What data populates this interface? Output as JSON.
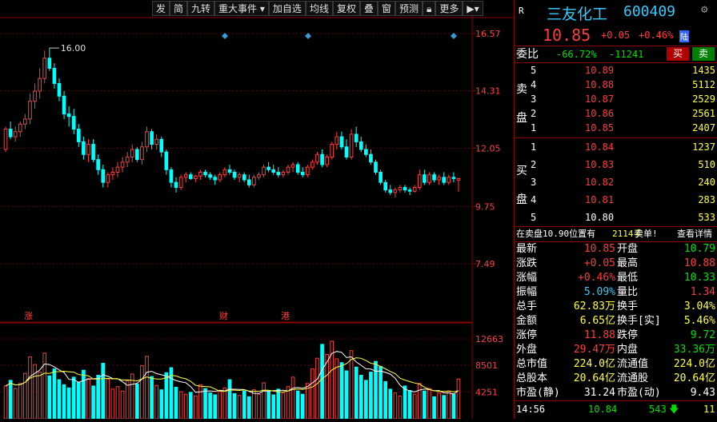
{
  "toolbar": {
    "items": [
      "发",
      "简",
      "九转",
      "重大事件",
      "加自选",
      "均线",
      "复权",
      "叠",
      "窗",
      "预测",
      "锁",
      "更多",
      "播放"
    ]
  },
  "price_axis": [
    "16.57",
    "14.31",
    "12.05",
    "9.75",
    "7.49"
  ],
  "volume_axis": [
    "12663",
    "8501",
    "4251"
  ],
  "peak_label": "16.00",
  "event_markers": [
    "涨",
    "财",
    "港"
  ],
  "header": {
    "badge": "R",
    "name": "三友化工",
    "code": "600409",
    "price": "10.85",
    "change": "+0.05",
    "change_pct": "+0.46%",
    "exchange": "陆"
  },
  "webi": {
    "label": "委比",
    "pct": "-66.72%",
    "diff": "-11241",
    "buy_btn": "买",
    "sell_btn": "卖"
  },
  "sell_side": {
    "side_label_1": "卖",
    "side_label_2": "盘",
    "levels": [
      {
        "lvl": "5",
        "price": "10.89",
        "vol": "1435"
      },
      {
        "lvl": "4",
        "price": "10.88",
        "vol": "5112"
      },
      {
        "lvl": "3",
        "price": "10.87",
        "vol": "2529"
      },
      {
        "lvl": "2",
        "price": "10.86",
        "vol": "2561"
      },
      {
        "lvl": "1",
        "price": "10.85",
        "vol": "2407"
      }
    ]
  },
  "buy_side": {
    "side_label_1": "买",
    "side_label_2": "盘",
    "levels": [
      {
        "lvl": "1",
        "price": "10.84",
        "vol": "1237"
      },
      {
        "lvl": "2",
        "price": "10.83",
        "vol": "510"
      },
      {
        "lvl": "3",
        "price": "10.82",
        "vol": "240"
      },
      {
        "lvl": "4",
        "price": "10.81",
        "vol": "283"
      },
      {
        "lvl": "5",
        "price": "10.80",
        "vol": "533"
      }
    ]
  },
  "notice": {
    "pre": "在卖盘10.90位置有",
    "qty": "2114手",
    "post": "卖单!",
    "link": "查看详情"
  },
  "stats": [
    {
      "l1": "最新",
      "v1": "10.85",
      "c1": "red",
      "l2": "开盘",
      "v2": "10.79",
      "c2": "green"
    },
    {
      "l1": "涨跌",
      "v1": "+0.05",
      "c1": "red",
      "l2": "最高",
      "v2": "10.88",
      "c2": "red"
    },
    {
      "l1": "涨幅",
      "v1": "+0.46%",
      "c1": "red",
      "l2": "最低",
      "v2": "10.33",
      "c2": "green"
    },
    {
      "l1": "振幅",
      "v1": "5.09%",
      "c1": "cyan",
      "l2": "量比",
      "v2": "1.34",
      "c2": "red"
    },
    {
      "l1": "总手",
      "v1": "62.83万",
      "c1": "yellow",
      "l2": "换手",
      "v2": "3.04%",
      "c2": "yellow"
    },
    {
      "l1": "金额",
      "v1": "6.65亿",
      "c1": "yellow",
      "l2": "换手[实]",
      "v2": "5.46%",
      "c2": "yellow"
    },
    {
      "l1": "涨停",
      "v1": "11.88",
      "c1": "red",
      "l2": "跌停",
      "v2": "9.72",
      "c2": "green"
    },
    {
      "l1": "外盘",
      "v1": "29.47万",
      "c1": "red",
      "l2": "内盘",
      "v2": "33.36万",
      "c2": "green"
    },
    {
      "l1": "总市值",
      "v1": "224.0亿",
      "c1": "yellow",
      "l2": "流通值",
      "v2": "224.0亿",
      "c2": "yellow"
    },
    {
      "l1": "总股本",
      "v1": "20.64亿",
      "c1": "yellow",
      "l2": "流通股",
      "v2": "20.64亿",
      "c2": "yellow"
    },
    {
      "l1": "市盈(静)",
      "v1": "31.24",
      "c1": "white",
      "l2": "市盈(动)",
      "v2": "9.43",
      "c2": "white"
    }
  ],
  "tick": {
    "time": "14:56",
    "price": "10.84",
    "vol": "543",
    "count": "11"
  },
  "colors": {
    "up": "#ff3c3c",
    "down": "#00ffff",
    "frame": "#8b0000"
  },
  "chart_data": {
    "type": "candlestick",
    "yaxis_price": [
      7.49,
      16.57
    ],
    "yaxis_volume": [
      0,
      12663
    ],
    "candles": [
      [
        12.0,
        12.9,
        11.9,
        12.8
      ],
      [
        12.8,
        13.1,
        12.4,
        12.5
      ],
      [
        12.5,
        12.9,
        12.3,
        12.7
      ],
      [
        12.7,
        13.1,
        12.5,
        13.0
      ],
      [
        13.0,
        13.4,
        12.8,
        13.2
      ],
      [
        13.2,
        14.2,
        13.0,
        13.9
      ],
      [
        13.9,
        14.6,
        13.6,
        14.3
      ],
      [
        14.3,
        15.2,
        14.0,
        14.8
      ],
      [
        14.8,
        15.9,
        14.6,
        15.6
      ],
      [
        15.6,
        16.0,
        15.1,
        15.2
      ],
      [
        15.2,
        15.4,
        14.4,
        14.6
      ],
      [
        14.6,
        14.8,
        13.9,
        14.1
      ],
      [
        14.1,
        14.3,
        13.2,
        13.4
      ],
      [
        13.4,
        13.7,
        12.9,
        13.3
      ],
      [
        13.3,
        13.6,
        12.6,
        12.8
      ],
      [
        12.8,
        13.0,
        12.1,
        12.3
      ],
      [
        12.3,
        12.5,
        11.6,
        11.8
      ],
      [
        11.8,
        12.4,
        11.5,
        12.2
      ],
      [
        12.2,
        12.4,
        11.5,
        11.6
      ],
      [
        11.6,
        11.8,
        11.0,
        11.2
      ],
      [
        11.2,
        11.4,
        10.5,
        10.7
      ],
      [
        10.7,
        11.1,
        10.5,
        11.0
      ],
      [
        11.0,
        11.3,
        10.8,
        11.1
      ],
      [
        11.1,
        11.5,
        10.9,
        11.3
      ],
      [
        11.3,
        11.7,
        11.1,
        11.5
      ],
      [
        11.5,
        11.9,
        11.3,
        11.7
      ],
      [
        11.7,
        12.2,
        11.5,
        12.0
      ],
      [
        12.0,
        12.1,
        11.5,
        11.6
      ],
      [
        11.6,
        12.3,
        11.4,
        12.1
      ],
      [
        12.1,
        12.9,
        11.9,
        12.7
      ],
      [
        12.7,
        12.8,
        12.0,
        12.2
      ],
      [
        12.2,
        12.6,
        12.0,
        12.4
      ],
      [
        12.4,
        12.5,
        11.7,
        11.9
      ],
      [
        11.9,
        12.0,
        11.0,
        11.2
      ],
      [
        11.2,
        11.3,
        10.5,
        10.7
      ],
      [
        10.7,
        10.9,
        10.3,
        10.5
      ],
      [
        10.5,
        11.0,
        10.4,
        10.9
      ],
      [
        10.9,
        11.1,
        10.7,
        11.0
      ],
      [
        11.0,
        11.1,
        10.8,
        10.85
      ],
      [
        10.85,
        11.0,
        10.7,
        10.95
      ],
      [
        10.95,
        11.2,
        10.8,
        11.1
      ],
      [
        11.1,
        11.2,
        10.9,
        11.0
      ],
      [
        11.0,
        11.1,
        10.8,
        10.9
      ],
      [
        10.9,
        11.0,
        10.6,
        10.8
      ],
      [
        10.8,
        11.1,
        10.7,
        11.0
      ],
      [
        11.0,
        11.3,
        10.9,
        11.2
      ],
      [
        11.2,
        11.4,
        11.0,
        11.1
      ],
      [
        11.1,
        11.2,
        10.8,
        10.9
      ],
      [
        10.9,
        11.1,
        10.7,
        11.0
      ],
      [
        11.0,
        11.1,
        10.7,
        10.8
      ],
      [
        10.8,
        11.0,
        10.5,
        10.6
      ],
      [
        10.6,
        11.0,
        10.5,
        10.9
      ],
      [
        10.9,
        11.1,
        10.8,
        11.0
      ],
      [
        11.0,
        11.4,
        10.9,
        11.3
      ],
      [
        11.3,
        11.5,
        11.1,
        11.2
      ],
      [
        11.2,
        11.4,
        11.0,
        11.1
      ],
      [
        11.1,
        11.3,
        10.9,
        11.0
      ],
      [
        11.0,
        11.2,
        10.9,
        11.1
      ],
      [
        11.1,
        11.4,
        11.0,
        11.3
      ],
      [
        11.3,
        11.5,
        11.1,
        11.4
      ],
      [
        11.4,
        11.5,
        11.0,
        11.1
      ],
      [
        11.1,
        11.3,
        10.9,
        11.0
      ],
      [
        11.0,
        11.4,
        10.9,
        11.3
      ],
      [
        11.3,
        11.6,
        11.2,
        11.5
      ],
      [
        11.5,
        11.9,
        11.4,
        11.8
      ],
      [
        11.8,
        12.0,
        11.3,
        11.4
      ],
      [
        11.4,
        11.8,
        11.3,
        11.7
      ],
      [
        11.7,
        12.3,
        11.6,
        12.2
      ],
      [
        12.2,
        12.7,
        12.0,
        12.5
      ],
      [
        12.5,
        12.7,
        12.0,
        12.1
      ],
      [
        12.1,
        12.4,
        11.6,
        11.7
      ],
      [
        11.7,
        12.8,
        11.6,
        12.6
      ],
      [
        12.6,
        12.9,
        12.1,
        12.3
      ],
      [
        12.3,
        12.5,
        11.9,
        12.0
      ],
      [
        12.0,
        12.2,
        11.7,
        11.8
      ],
      [
        11.8,
        12.0,
        11.4,
        11.5
      ],
      [
        11.5,
        11.6,
        11.0,
        11.1
      ],
      [
        11.1,
        11.2,
        10.6,
        10.7
      ],
      [
        10.7,
        10.8,
        10.3,
        10.4
      ],
      [
        10.4,
        10.6,
        10.2,
        10.3
      ],
      [
        10.3,
        10.5,
        10.1,
        10.4
      ],
      [
        10.4,
        10.6,
        10.3,
        10.5
      ],
      [
        10.5,
        10.6,
        10.3,
        10.4
      ],
      [
        10.4,
        10.5,
        10.2,
        10.35
      ],
      [
        10.35,
        10.6,
        10.3,
        10.5
      ],
      [
        10.5,
        11.2,
        10.4,
        11.0
      ],
      [
        11.0,
        11.2,
        10.6,
        10.7
      ],
      [
        10.7,
        11.1,
        10.6,
        11.0
      ],
      [
        11.0,
        11.1,
        10.7,
        10.8
      ],
      [
        10.8,
        11.0,
        10.6,
        10.9
      ],
      [
        10.9,
        11.1,
        10.6,
        10.7
      ],
      [
        10.7,
        11.0,
        10.6,
        10.9
      ],
      [
        10.9,
        11.1,
        10.7,
        10.85
      ],
      [
        10.79,
        10.88,
        10.33,
        10.85
      ]
    ],
    "volumes": [
      5200,
      6100,
      4800,
      5600,
      7200,
      9800,
      8600,
      7400,
      10400,
      6800,
      7900,
      6200,
      5400,
      4900,
      6600,
      5800,
      7700,
      6400,
      5200,
      6900,
      8800,
      6300,
      4700,
      5100,
      4400,
      6000,
      7100,
      5500,
      8400,
      9900,
      6700,
      5300,
      4600,
      7300,
      8100,
      5000,
      4300,
      3900,
      4200,
      3600,
      5400,
      4800,
      4100,
      3800,
      4500,
      4900,
      6200,
      4000,
      3700,
      4400,
      3500,
      4600,
      3900,
      5700,
      4300,
      3800,
      4700,
      4100,
      5100,
      6600,
      4400,
      3900,
      5600,
      7900,
      9600,
      11800,
      10200,
      12300,
      9500,
      8900,
      7600,
      10800,
      8200,
      6900,
      6100,
      7400,
      9100,
      8300,
      5900,
      4700,
      4100,
      3600,
      5200,
      4500,
      3900,
      5600,
      4400,
      4800,
      3500,
      4100,
      3700,
      4400,
      3900,
      6300
    ]
  }
}
